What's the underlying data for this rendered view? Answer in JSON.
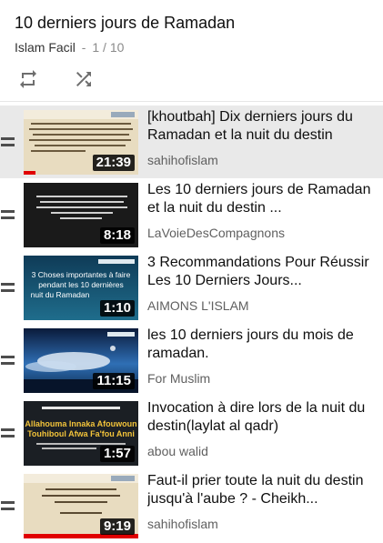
{
  "playlist": {
    "title": "10 derniers jours de Ramadan",
    "channel": "Islam Facil",
    "separator": "-",
    "position": "1 / 10",
    "loop_icon": "loop-icon",
    "shuffle_icon": "shuffle-icon"
  },
  "colors": {
    "active_row": "#e9e9e9",
    "progress": "#e00000",
    "secondary_text": "#606060"
  },
  "videos": [
    {
      "title": "[khoutbah] Dix derniers jours du Ramadan et la nuit du destin",
      "channel": "sahihofislam",
      "duration": "21:39",
      "active": true,
      "watched_fraction": 0.1,
      "thumb_text": ""
    },
    {
      "title": "Les 10 derniers jours de Ramadan et la nuit du destin ...",
      "channel": "LaVoieDesCompagnons",
      "duration": "8:18",
      "active": false,
      "thumb_text": ""
    },
    {
      "title": "3 Recommandations Pour Réussir Les 10 Derniers Jours...",
      "channel": "AIMONS L'ISLAM",
      "duration": "1:10",
      "active": false,
      "thumb_text": "3 Choses importantes à faire pendant les 10 dernières nuit du Ramadan"
    },
    {
      "title": "les 10 derniers jours du mois de ramadan.",
      "channel": "For Muslim",
      "duration": "11:15",
      "active": false,
      "thumb_text": ""
    },
    {
      "title": "Invocation à dire lors de la nuit du destin(laylat al qadr)",
      "channel": "abou walid",
      "duration": "1:57",
      "active": false,
      "thumb_text": "Allahouma Innaka Afouwoun Touhiboul Afwa Fa'fou Anni"
    },
    {
      "title": "Faut-il prier toute la nuit du destin jusqu'à l'aube ? - Cheikh...",
      "channel": "sahihofislam",
      "duration": "9:19",
      "active": false,
      "thumb_text": ""
    }
  ]
}
